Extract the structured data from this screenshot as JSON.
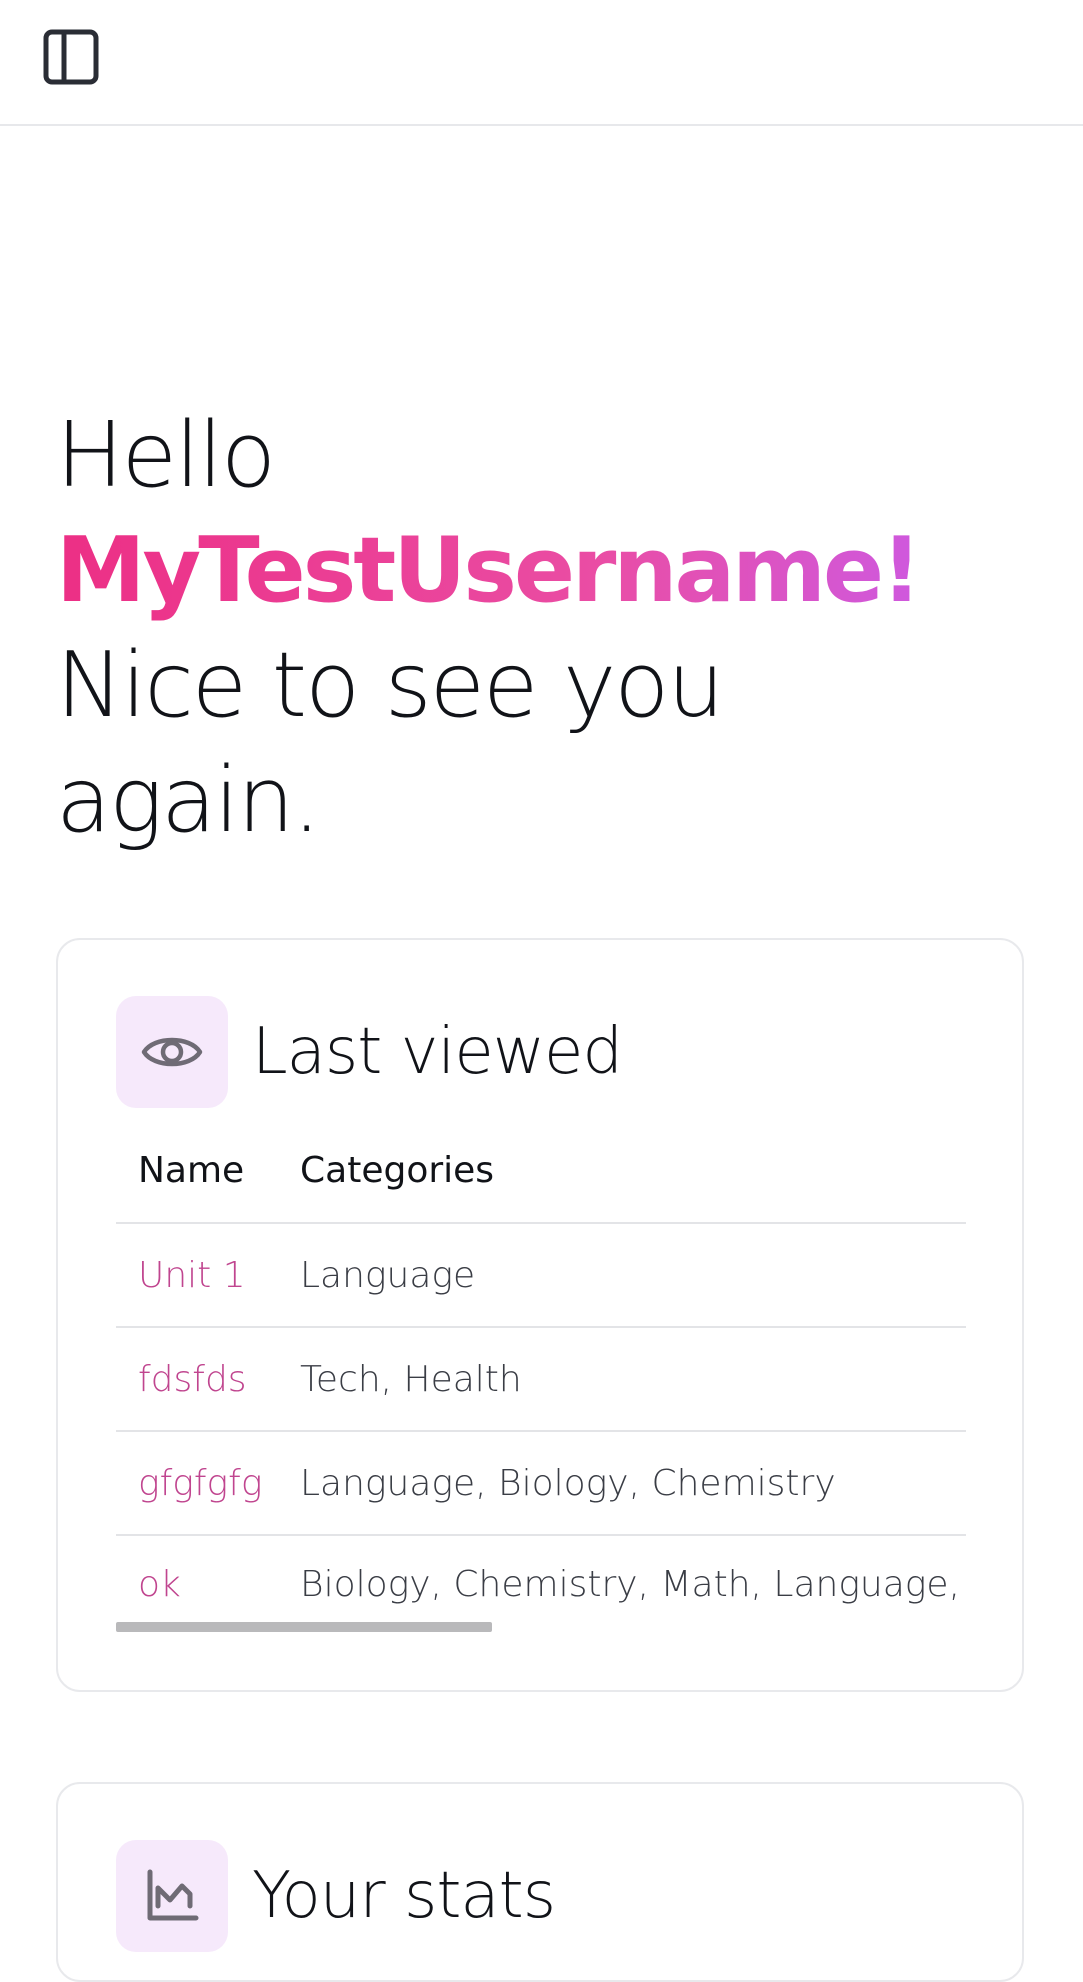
{
  "topbar": {
    "toggle_icon": "sidebar-panel-icon"
  },
  "greeting": {
    "hello": "Hello",
    "username": "MyTestUsername!",
    "line3": "Nice to see you",
    "line4": "again."
  },
  "last_viewed": {
    "icon": "eye-icon",
    "title": "Last viewed",
    "columns": [
      "Name",
      "Categories"
    ],
    "rows": [
      {
        "name": "Unit 1",
        "categories": "Language"
      },
      {
        "name": "fdsfds",
        "categories": "Tech, Health"
      },
      {
        "name": "gfgfgfg",
        "categories": "Language, Biology, Chemistry"
      },
      {
        "name": "ok",
        "categories": "Biology, Chemistry, Math, Language, IT"
      }
    ]
  },
  "stats": {
    "icon": "chart-icon",
    "title": "Your stats"
  },
  "colors": {
    "accent_pink": "#ec2f85",
    "accent_purple": "#c55df3",
    "link": "#c0458f",
    "icon_badge_bg": "#f6e9fb"
  }
}
